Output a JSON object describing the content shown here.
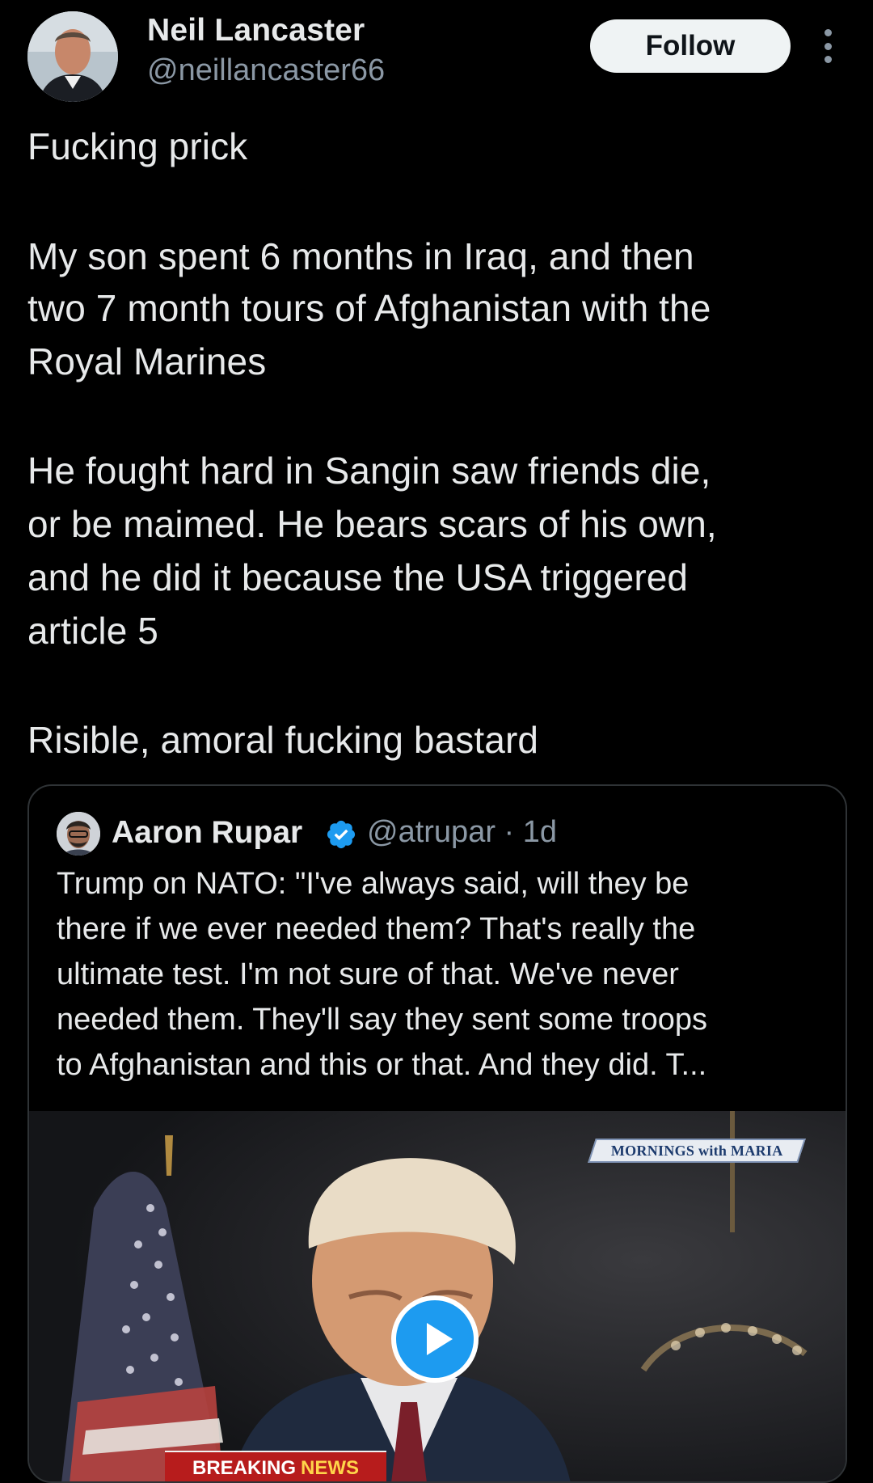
{
  "author": {
    "name": "Neil Lancaster",
    "handle": "@neillancaster66",
    "follow_label": "Follow"
  },
  "post": {
    "lines": [
      "Fucking prick",
      "My son spent 6 months in Iraq, and then",
      "two 7 month tours of Afghanistan with the",
      "Royal Marines",
      "He fought hard in Sangin saw friends die,",
      "or be maimed. He bears scars of his own,",
      "and he did it because the USA triggered",
      "article 5",
      "Risible, amoral fucking bastard"
    ]
  },
  "quote": {
    "name": "Aaron Rupar",
    "handle_time": "@atrupar · 1d",
    "lines": [
      "Trump on NATO: \"I've always said, will they be",
      "there if we ever needed them? That's really the",
      "ultimate test. I'm not sure of that. We've never",
      "needed them. They'll say they sent some troops",
      "to Afghanistan and this or that. And they did. T..."
    ],
    "media": {
      "logo_text": "MORNINGS with MARIA",
      "banner_word1": "BREAKING",
      "banner_word2": "NEWS"
    }
  },
  "colors": {
    "background": "#000000",
    "text": "#e7e9ea",
    "secondary": "#8b98a5",
    "verified": "#1d9bf0",
    "border": "#2f3336"
  },
  "icons": [
    "more-icon",
    "verified-icon",
    "play-icon"
  ]
}
